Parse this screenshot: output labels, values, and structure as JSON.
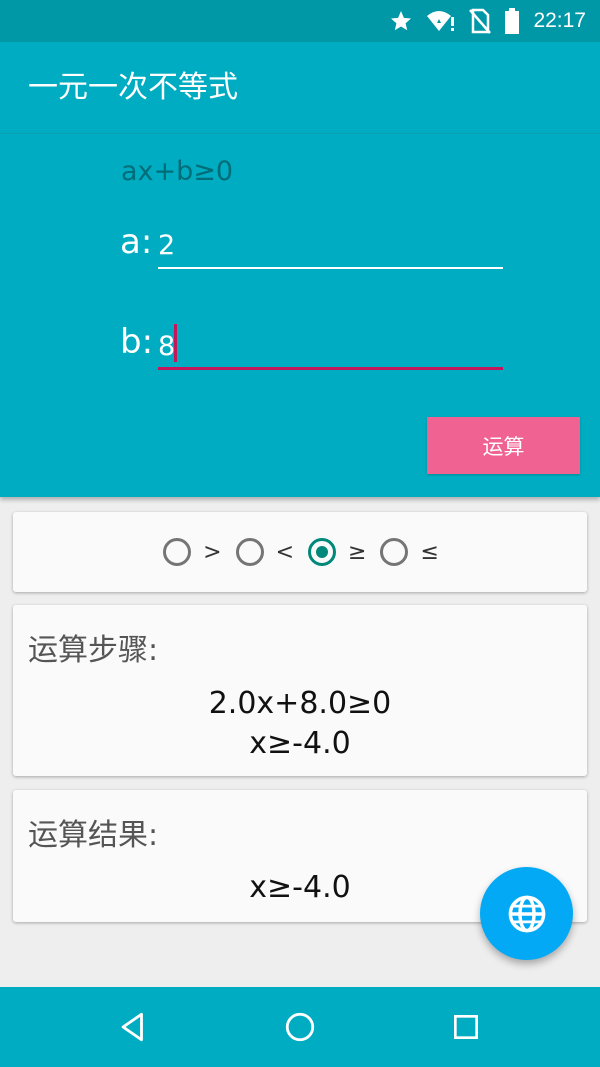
{
  "status_bar": {
    "time": "22:17",
    "icons": [
      "star-icon",
      "wifi-alert-icon",
      "no-sim-icon",
      "battery-icon"
    ]
  },
  "toolbar": {
    "title": "一元一次不等式"
  },
  "inputs": {
    "formula": "ax+b≥0",
    "a_label": "a:",
    "a_value": "2",
    "b_label": "b:",
    "b_value": "8"
  },
  "calc_button": {
    "label": "运算"
  },
  "operators": {
    "options": [
      {
        "label": ">",
        "checked": false
      },
      {
        "label": "<",
        "checked": false
      },
      {
        "label": "≥",
        "checked": true
      },
      {
        "label": "≤",
        "checked": false
      }
    ]
  },
  "steps": {
    "heading": "运算步骤:",
    "lines": [
      "2.0x+8.0≥0",
      "x≥-4.0"
    ]
  },
  "result": {
    "heading": "运算结果:",
    "value": "x≥-4.0"
  },
  "fab": {
    "icon": "globe-icon"
  },
  "nav": {
    "icons": [
      "back-icon",
      "home-icon",
      "recents-icon"
    ]
  },
  "colors": {
    "primary": "#00acc1",
    "primary_dark": "#0097a7",
    "accent": "#f06292",
    "fab": "#03a9f4",
    "radio_checked": "#00897b"
  }
}
